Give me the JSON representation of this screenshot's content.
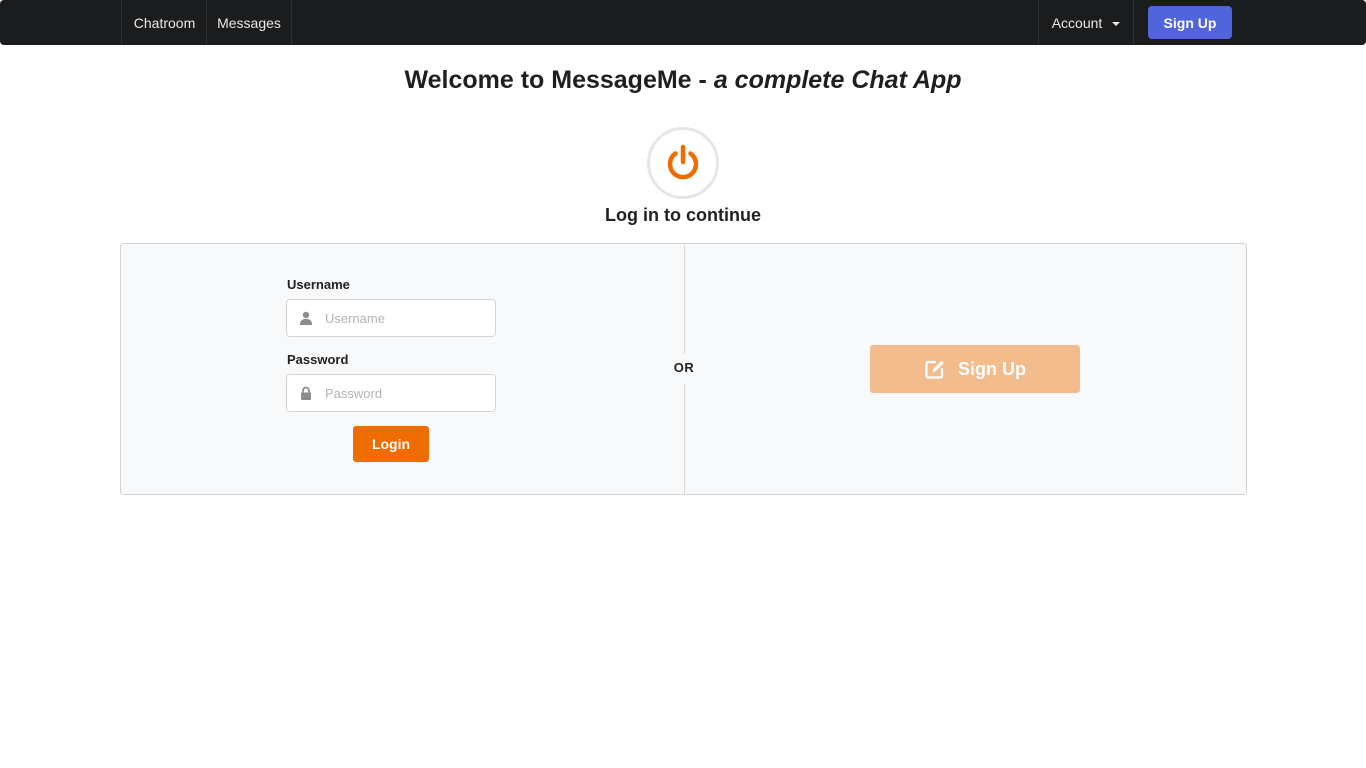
{
  "nav": {
    "chatroom": "Chatroom",
    "messages": "Messages",
    "account": "Account",
    "signup": "Sign Up"
  },
  "welcome": {
    "prefix": "Welcome to MessageMe - ",
    "tagline": "a complete Chat App"
  },
  "login_heading": "Log in to continue",
  "form": {
    "username_label": "Username",
    "username_placeholder": "Username",
    "password_label": "Password",
    "password_placeholder": "Password",
    "login_button": "Login"
  },
  "divider_label": "OR",
  "signup_panel_button": "Sign Up",
  "icons": {
    "power": "power-icon",
    "user": "user-icon",
    "lock": "lock-icon",
    "edit": "edit-icon",
    "caret": "caret-down-icon"
  },
  "colors": {
    "navbar": "#1b1c1d",
    "nav_signup": "#5164dc",
    "accent_orange": "#ef6c00",
    "signup_disabled": "#f3bc8c"
  }
}
